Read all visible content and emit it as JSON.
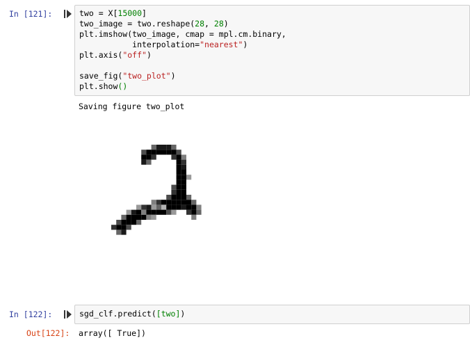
{
  "cells": [
    {
      "prompt": "In [121]:",
      "code_lines": [
        [
          "two = X[",
          "15000",
          "]"
        ],
        [
          "two_image = two.reshape(",
          "28",
          ", ",
          "28",
          ")"
        ],
        [
          "plt.imshow(two_image, cmap = mpl.cm.binary,"
        ],
        [
          "           interpolation=",
          "\"nearest\"",
          ")"
        ],
        [
          "plt.axis(",
          "\"off\"",
          ")"
        ],
        [
          ""
        ],
        [
          "save_fig(",
          "\"two_plot\"",
          ")"
        ],
        [
          "plt.show",
          "()"
        ]
      ],
      "output_text": "Saving figure two_plot",
      "output_image": "digit-two-image"
    },
    {
      "prompt": "In [122]:",
      "code_lines": [
        [
          "sgd_clf.predict(",
          "[two]",
          ")"
        ]
      ],
      "output_prompt": "Out[122]:",
      "output_text": "array([ True])"
    }
  ],
  "icons": {
    "run": "run-cell-icon"
  },
  "colors": {
    "in_prompt": "#303f9f",
    "out_prompt": "#d84315",
    "number": "#008000",
    "string": "#ba2121",
    "cell_bg": "#f7f7f7",
    "cell_border": "#cfcfcf"
  }
}
